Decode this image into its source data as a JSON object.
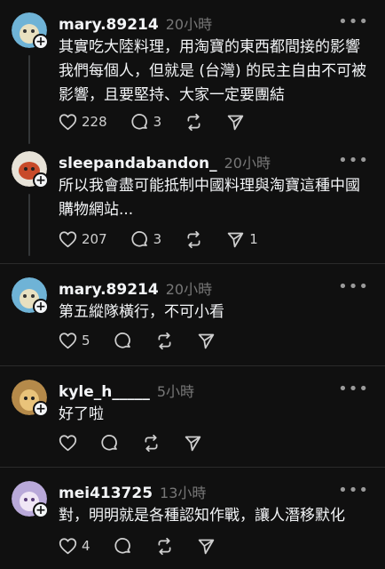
{
  "posts": [
    {
      "username": "mary.89214",
      "time": "20小時",
      "text": "其實吃大陸料理，用淘寶的東西都間接的影響我們每個人，但就是 (台灣) 的民主自由不可被影響，且要堅持、大家一定要團結",
      "likes": "228",
      "replies": "3",
      "reposts": "",
      "shares": "",
      "avatar_colors": [
        "#6fb3d6",
        "#e8e0c0"
      ]
    },
    {
      "username": "sleepandabandon_",
      "time": "20小時",
      "text": "所以我會盡可能抵制中國料理與淘寶這種中國購物網站...",
      "likes": "207",
      "replies": "3",
      "reposts": "",
      "shares": "1",
      "avatar_colors": [
        "#e7e2d8",
        "#c84a2a"
      ]
    },
    {
      "username": "mary.89214",
      "time": "20小時",
      "text": "第五縱隊橫行，不可小看",
      "likes": "5",
      "replies": "",
      "reposts": "",
      "shares": "",
      "avatar_colors": [
        "#6fb3d6",
        "#e8e0c0"
      ]
    },
    {
      "username": "kyle_h_____",
      "time": "5小時",
      "text": "好了啦",
      "likes": "",
      "replies": "",
      "reposts": "",
      "shares": "",
      "avatar_colors": [
        "#b58a4a",
        "#e9c37a"
      ]
    },
    {
      "username": "mei413725",
      "time": "13小時",
      "text": "對，明明就是各種認知作戰，讓人潛移默化",
      "likes": "4",
      "replies": "",
      "reposts": "",
      "shares": "",
      "avatar_colors": [
        "#b9a9d9",
        "#f0e6f5"
      ]
    }
  ],
  "more_label": "•••",
  "icons": {
    "like": "heart-icon",
    "reply": "comment-icon",
    "repost": "repost-icon",
    "share": "send-icon",
    "follow": "plus-icon"
  }
}
